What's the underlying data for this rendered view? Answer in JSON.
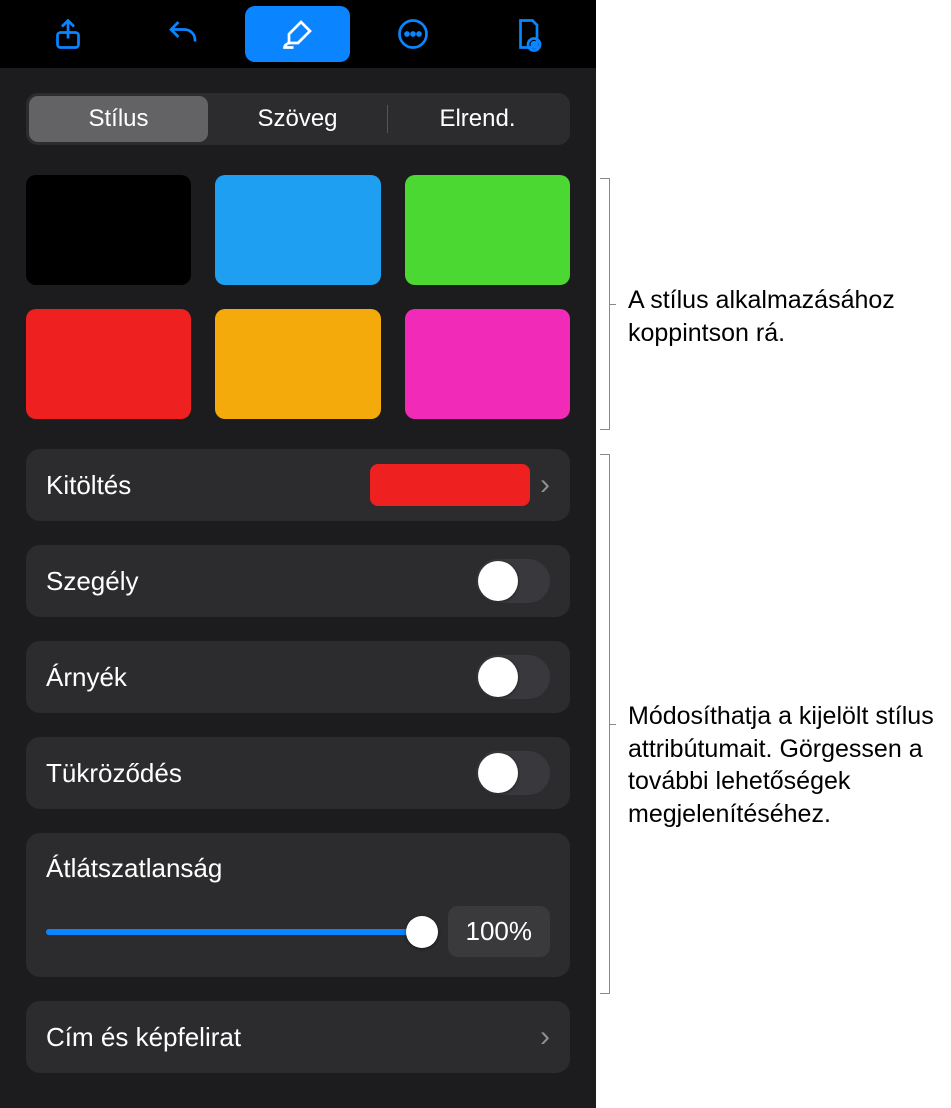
{
  "toolbar": {
    "icons": [
      "share",
      "undo",
      "brush",
      "more",
      "doc"
    ],
    "active": "brush"
  },
  "tabs": {
    "items": [
      "Stílus",
      "Szöveg",
      "Elrend."
    ],
    "selected": 0
  },
  "swatches": [
    {
      "color": "#000000"
    },
    {
      "color": "#1e9ff1"
    },
    {
      "color": "#4cd832"
    },
    {
      "color": "#ee2020"
    },
    {
      "color": "#f5aa0c"
    },
    {
      "color": "#f22ab8"
    }
  ],
  "fill": {
    "label": "Kitöltés",
    "swatch": "#ee2020"
  },
  "border": {
    "label": "Szegély",
    "on": false
  },
  "shadow": {
    "label": "Árnyék",
    "on": false
  },
  "reflection": {
    "label": "Tükröződés",
    "on": false
  },
  "opacity": {
    "label": "Átlátszatlanság",
    "value": "100%",
    "pct": 100
  },
  "title_caption": {
    "label": "Cím és képfelirat"
  },
  "callouts": {
    "styles": "A stílus alkalmazásához koppintson rá.",
    "attrs": "Módosíthatja a kijelölt stílus attribútumait. Görgessen a további lehetőségek megjelenítéséhez."
  }
}
